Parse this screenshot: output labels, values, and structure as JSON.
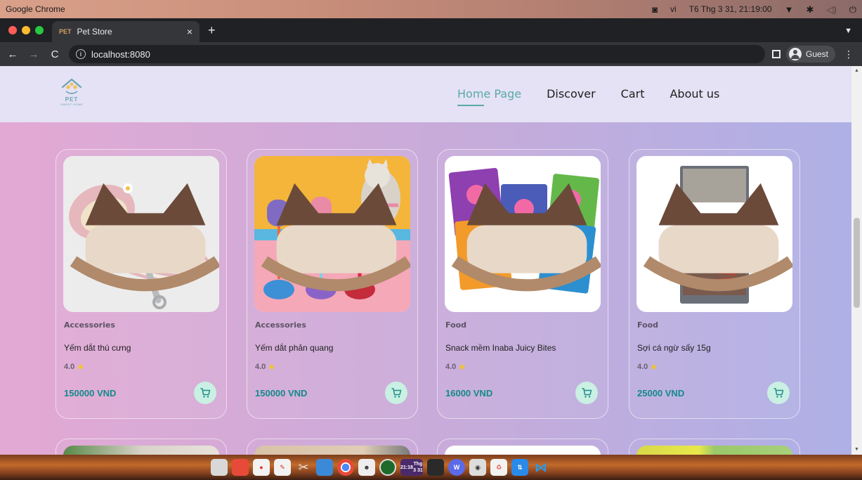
{
  "os": {
    "app_name": "Google Chrome",
    "input_method": "vi",
    "datetime": "T6 Thg 3 31, 21:19:00"
  },
  "browser": {
    "tab_title": "Pet Store",
    "tab_favicon": "PET",
    "url": "localhost:8080",
    "profile_label": "Guest"
  },
  "site": {
    "logo_text": "PET",
    "logo_subtext": "SWEET HOME",
    "nav": [
      {
        "label": "Home Page",
        "active": true
      },
      {
        "label": "Discover",
        "active": false
      },
      {
        "label": "Cart",
        "active": false
      },
      {
        "label": "About us",
        "active": false
      }
    ]
  },
  "products": [
    {
      "category": "Accessories",
      "name": "Yếm dắt thú cưng",
      "rating": "4.0",
      "price": "150000 VND",
      "image": "pink-leash-pouch"
    },
    {
      "category": "Accessories",
      "name": "Yếm dắt phản quang",
      "rating": "4.0",
      "price": "150000 VND",
      "image": "cat-harnesses-colorful"
    },
    {
      "category": "Food",
      "name": "Snack mềm Inaba Juicy Bites",
      "rating": "4.0",
      "price": "16000 VND",
      "image": "juicy-bites-packs"
    },
    {
      "category": "Food",
      "name": "Sợi cá ngừ sấy 15g",
      "rating": "4.0",
      "price": "25000 VND",
      "image": "tuna-snack-pack"
    }
  ],
  "dock": {
    "clock_time": "21:18",
    "clock_date": "Thg 3 31"
  },
  "colors": {
    "accent": "#5aa9a8",
    "price": "#138a8a",
    "cart_button_bg": "#c9f0e2",
    "header_bg": "#e4e2f4"
  }
}
